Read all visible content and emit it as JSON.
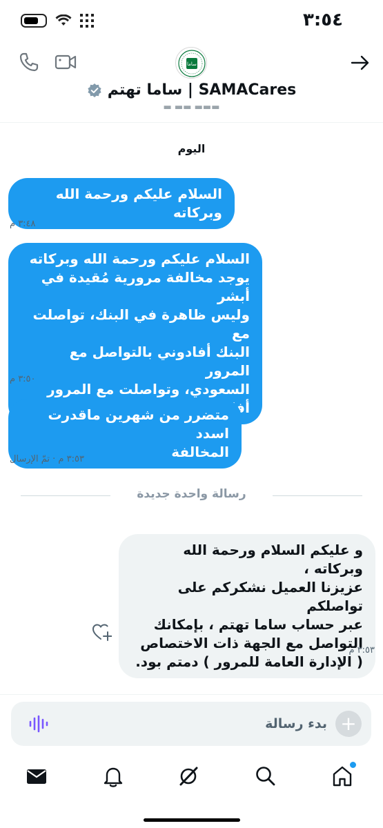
{
  "status_bar": {
    "time": "٣:٥٤"
  },
  "header": {
    "name": "ساما تهتم | SAMACares",
    "avatar_text": "ساما",
    "icons": {
      "back": "arrow-right-icon",
      "call": "phone-icon",
      "video": "video-icon",
      "verified": "verified-badge-icon"
    }
  },
  "conversation": {
    "day_label": "اليوم",
    "outgoing": [
      {
        "text": "السلام عليكم ورحمة الله وبركاته",
        "meta": "٣:٤٨ م"
      },
      {
        "text": "السلام عليكم ورحمة الله وبركاته\nيوجد مخالفة مرورية مُقيدة في أبشر\nوليس ظاهرة في البنك، تواصلت مع\nالبنك أفادوني بالتواصل مع المرور\nالسعودي، وتواصلت مع المرور\nأفادوني بالتواصل معكم",
        "meta": "٣:٥٠ م"
      },
      {
        "text": "متضرر من شهرين ماقدرت اسدد\nالمخالفة",
        "meta": "٣:٥٣ م · تمّ الإرسال"
      }
    ],
    "new_message_divider": "رسالة واحدة جديدة",
    "incoming": [
      {
        "text": "و عليكم السلام ورحمة الله وبركاته ،\nعزيزنا العميل نشكركم على تواصلكم\nعبر حساب ساما تهتم ، بإمكانك\nالتواصل مع الجهة ذات الاختصاص\n( الإدارة العامة للمرور ) دمتم بود.",
        "meta": "٣:٥٣ م"
      }
    ]
  },
  "composer": {
    "placeholder": "بدء رسالة",
    "plus": "+"
  },
  "colors": {
    "accent": "#1d9bf0",
    "incoming_bubble": "#eff3f4",
    "voice": "#7856ff"
  },
  "bottom_nav": [
    {
      "icon": "home-icon",
      "active": true
    },
    {
      "icon": "search-icon"
    },
    {
      "icon": "grok-icon"
    },
    {
      "icon": "bell-icon"
    },
    {
      "icon": "mail-icon"
    }
  ]
}
